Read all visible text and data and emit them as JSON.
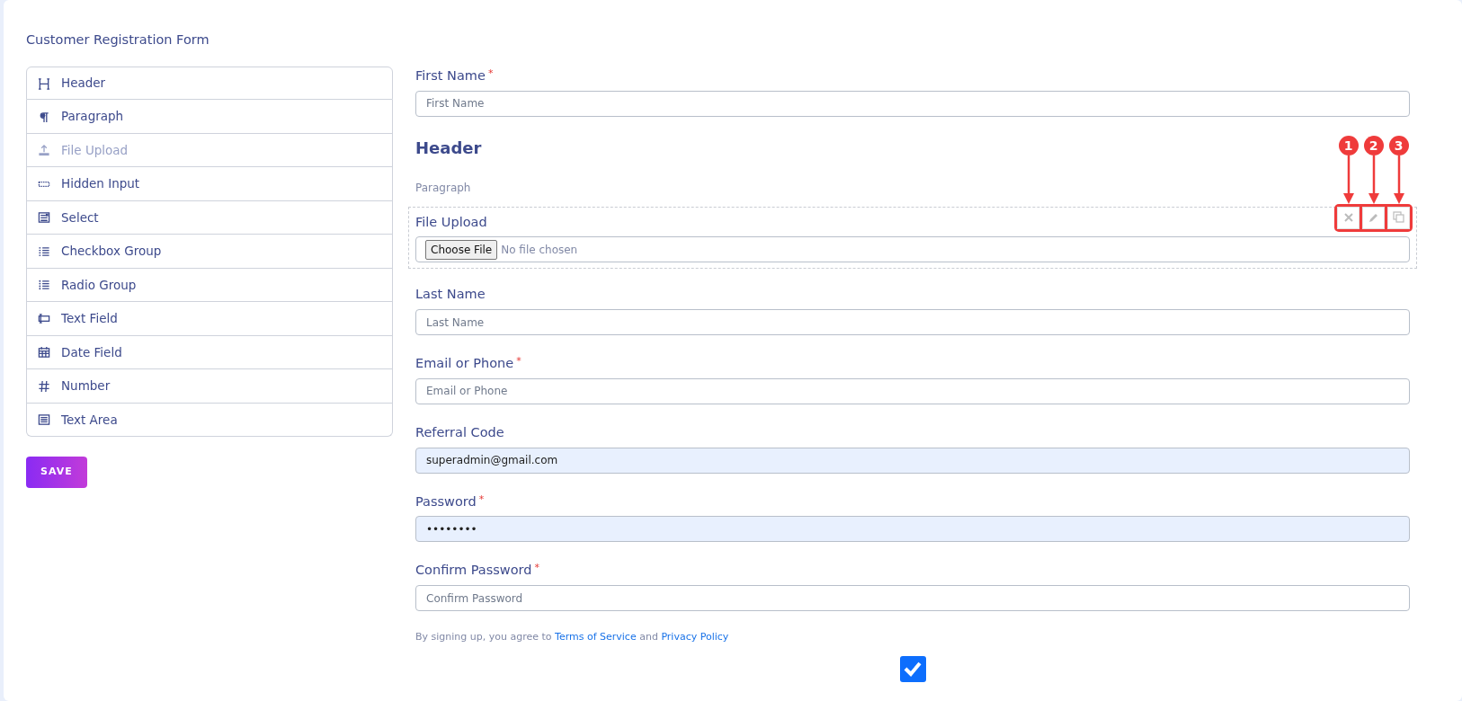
{
  "title": "Customer Registration Form",
  "palette": [
    {
      "kind": "header",
      "label": "Header",
      "disabled": false
    },
    {
      "kind": "paragraph",
      "label": "Paragraph",
      "disabled": false
    },
    {
      "kind": "file",
      "label": "File Upload",
      "disabled": true
    },
    {
      "kind": "hidden",
      "label": "Hidden Input",
      "disabled": false
    },
    {
      "kind": "select",
      "label": "Select",
      "disabled": false
    },
    {
      "kind": "checkbox",
      "label": "Checkbox Group",
      "disabled": false
    },
    {
      "kind": "radio",
      "label": "Radio Group",
      "disabled": false
    },
    {
      "kind": "text",
      "label": "Text Field",
      "disabled": false
    },
    {
      "kind": "date",
      "label": "Date Field",
      "disabled": false
    },
    {
      "kind": "number",
      "label": "Number",
      "disabled": false
    },
    {
      "kind": "textarea",
      "label": "Text Area",
      "disabled": false
    }
  ],
  "save_button": "SAVE",
  "fields": [
    {
      "kind": "text",
      "label": "First Name",
      "required_mark": "*",
      "placeholder": "First Name",
      "autofilled": false,
      "selected": false
    },
    {
      "kind": "header",
      "text": "Header",
      "selected": false
    },
    {
      "kind": "paragraph",
      "text": "Paragraph",
      "selected": false
    },
    {
      "kind": "file",
      "label": "File Upload",
      "button": "Choose File",
      "status": "No file chosen",
      "selected": true
    },
    {
      "kind": "text",
      "label": "Last Name",
      "placeholder": "Last Name",
      "autofilled": false,
      "selected": false
    },
    {
      "kind": "text",
      "label": "Email or Phone",
      "required_mark": "*",
      "placeholder": "Email or Phone",
      "autofilled": false,
      "selected": false
    },
    {
      "kind": "text",
      "label": "Referral Code",
      "value": "superadmin@gmail.com",
      "autofilled": true,
      "selected": false
    },
    {
      "kind": "text",
      "label": "Password",
      "required_mark": "*",
      "value": "••••••••",
      "autofilled": true,
      "selected": false
    },
    {
      "kind": "text",
      "label": "Confirm Password",
      "required_mark": "*",
      "placeholder": "Confirm Password",
      "autofilled": false,
      "selected": false
    }
  ],
  "field_actions": [
    {
      "kind": "delete"
    },
    {
      "kind": "edit"
    },
    {
      "kind": "copy"
    }
  ],
  "callouts": [
    "1",
    "2",
    "3"
  ],
  "terms": {
    "before": "By signing up, you agree to",
    "link_1": "Terms of Service",
    "middle": "and",
    "link_2": "Privacy Policy"
  },
  "agree_checkbox": {
    "checked": true
  }
}
